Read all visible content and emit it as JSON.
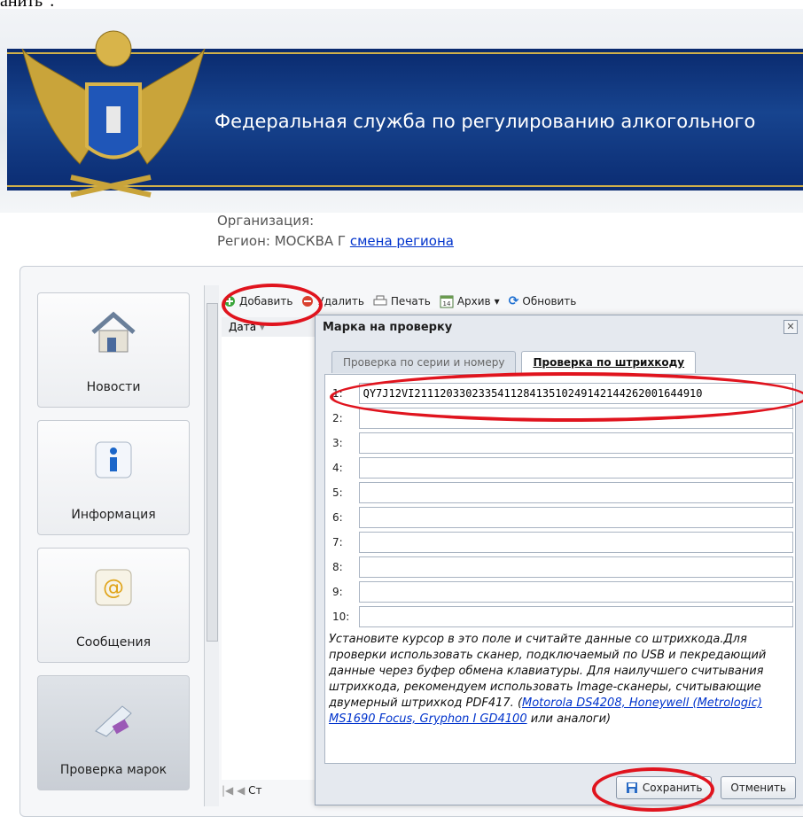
{
  "top_fragment": "анить\".",
  "header": {
    "title": "Федеральная служба по регулированию алкогольного",
    "organization_label": "Организация:",
    "region_label": "Регион: МОСКВА Г",
    "region_change_link": "смена региона"
  },
  "sidebar": {
    "items": [
      {
        "label": "Новости",
        "icon": "house-icon"
      },
      {
        "label": "Информация",
        "icon": "info-icon"
      },
      {
        "label": "Сообщения",
        "icon": "at-sign-icon"
      },
      {
        "label": "Проверка марок",
        "icon": "barcode-scanner-icon"
      }
    ]
  },
  "toolbar": {
    "add": "Добавить",
    "delete": "Удалить",
    "print": "Печать",
    "archive": "Архив",
    "archive_icon_text": "14",
    "refresh": "Обновить"
  },
  "grid": {
    "column_date": "Дата",
    "pager_text": "Ст"
  },
  "dialog": {
    "title": "Марка на проверку",
    "close": "✕",
    "tabs": [
      "Проверка по серии и номеру",
      "Проверка по штрихкоду"
    ],
    "rows": [
      {
        "num": "1:",
        "value": "QY7J12VI211120330233541128413510249142144262001644910"
      },
      {
        "num": "2:",
        "value": ""
      },
      {
        "num": "3:",
        "value": ""
      },
      {
        "num": "4:",
        "value": ""
      },
      {
        "num": "5:",
        "value": ""
      },
      {
        "num": "6:",
        "value": ""
      },
      {
        "num": "7:",
        "value": ""
      },
      {
        "num": "8:",
        "value": ""
      },
      {
        "num": "9:",
        "value": ""
      },
      {
        "num": "10:",
        "value": ""
      }
    ],
    "hint_text": "Установите курсор в это поле и считайте данные со штрихкода.Для проверки использовать сканер, подключаемый по USB и пекредающий данные через буфер обмена клавиатуры. Для наилучшего считывания штрихкода, рекомендуем использовать Image-сканеры, считывающие двумерный штрихкод PDF417. (",
    "hint_link": "Motorola DS4208, Honeywell (Metrologic) MS1690 Focus, Gryphon I GD4100",
    "hint_tail": " или аналоги)",
    "save": "Сохранить",
    "cancel": "Отменить"
  },
  "colors": {
    "banner": "#17448f",
    "highlight": "#e0141e",
    "link": "#0033cc"
  }
}
